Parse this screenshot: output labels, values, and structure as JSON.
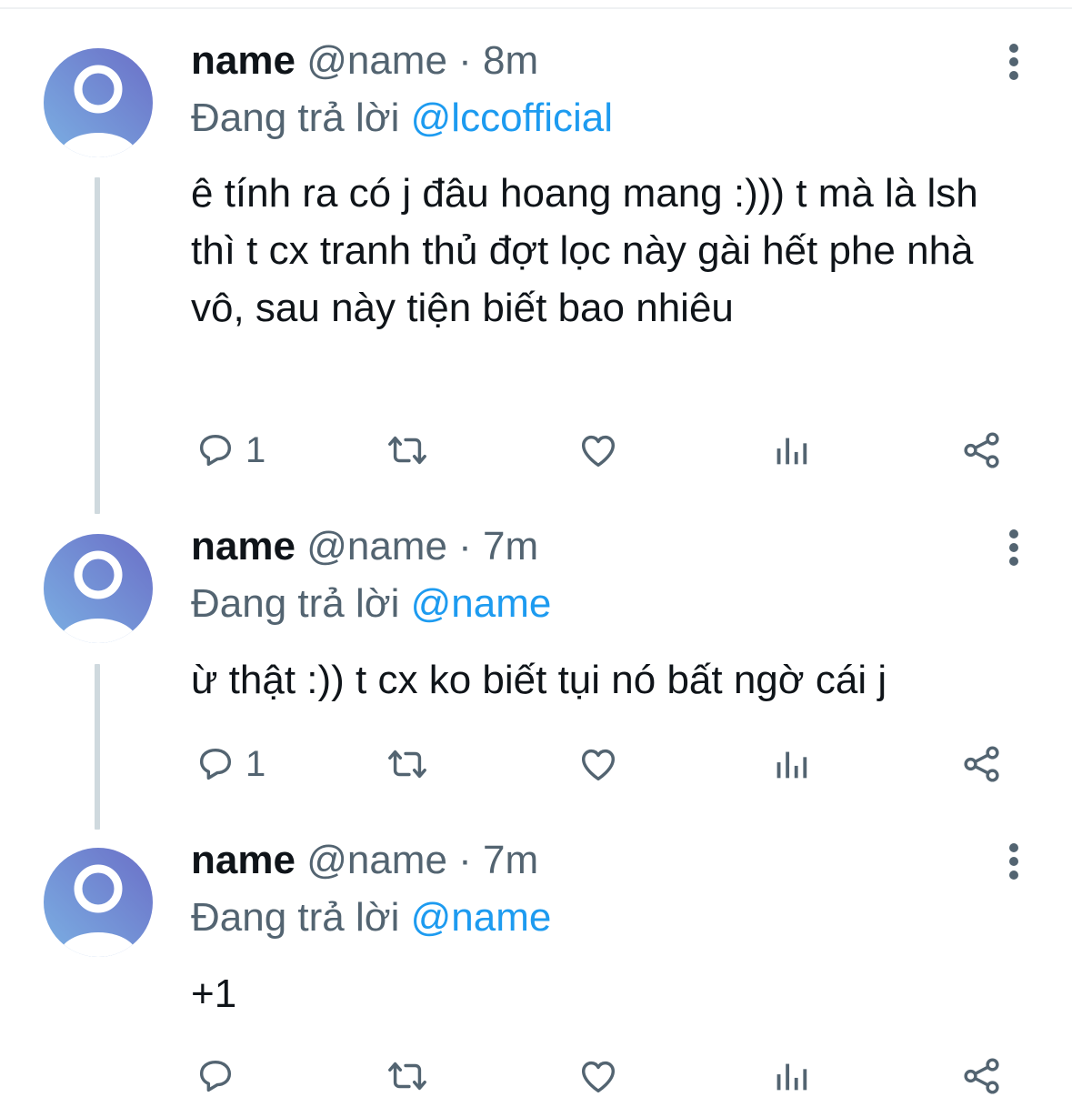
{
  "colors": {
    "name": "#0f1419",
    "meta": "#536471",
    "mention": "#1d9bf0",
    "thread_line": "#cfd9de",
    "avatar_gradient_start": "#7bb0e3",
    "avatar_gradient_end": "#6b6fc7"
  },
  "icons": {
    "reply": "reply-icon",
    "retweet": "retweet-icon",
    "like": "like-icon",
    "views": "views-icon",
    "share": "share-icon",
    "more": "more-icon",
    "avatar": "default-avatar-icon"
  },
  "tweets": [
    {
      "display_name": "name",
      "handle": "@name",
      "separator": "·",
      "time": "8m",
      "reply_prefix": "Đang trả lời",
      "reply_to": "@lccofficial",
      "text": "ê tính ra có j đâu hoang mang :))) t mà là lsh thì t cx tranh thủ đợt lọc này gài hết phe nhà vô, sau này tiện biết bao nhiêu",
      "reply_count": "1"
    },
    {
      "display_name": "name",
      "handle": "@name",
      "separator": "·",
      "time": "7m",
      "reply_prefix": "Đang trả lời",
      "reply_to": "@name",
      "text": "ừ thật :)) t cx ko biết tụi nó bất ngờ cái j",
      "reply_count": "1"
    },
    {
      "display_name": "name",
      "handle": "@name",
      "separator": "·",
      "time": "7m",
      "reply_prefix": "Đang trả lời",
      "reply_to": "@name",
      "text": "+1",
      "reply_count": ""
    }
  ]
}
